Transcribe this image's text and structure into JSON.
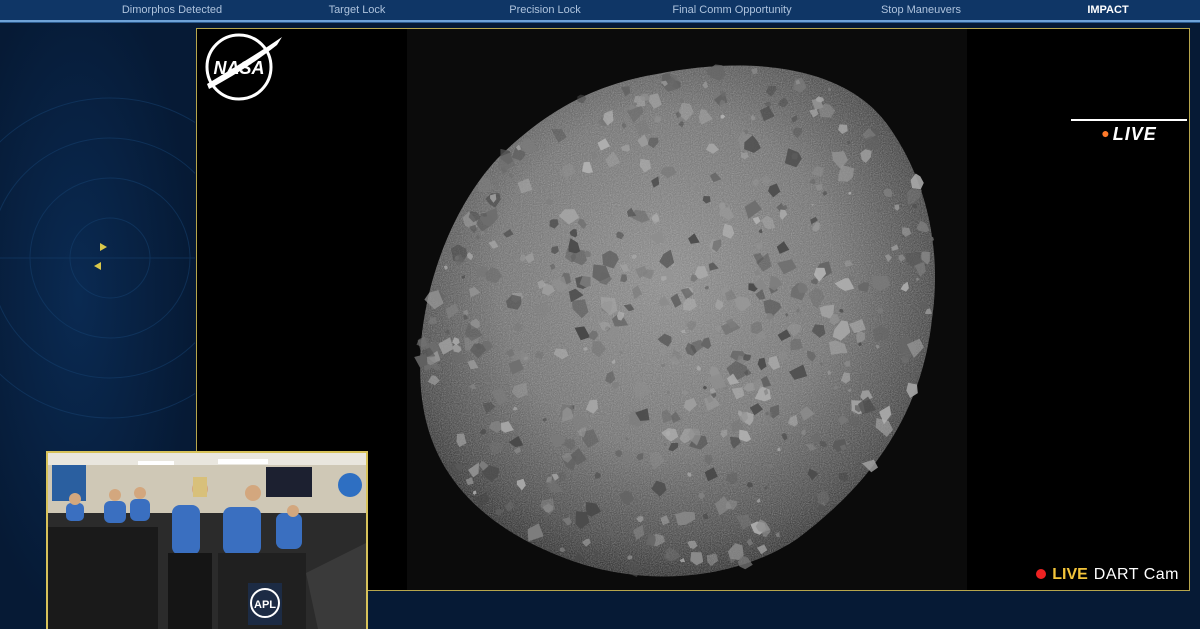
{
  "milestones": [
    {
      "label": "Dimorphos Detected",
      "active": false
    },
    {
      "label": "Target Lock",
      "active": false
    },
    {
      "label": "Precision Lock",
      "active": false
    },
    {
      "label": "Final Comm Opportunity",
      "active": false
    },
    {
      "label": "Stop Maneuvers",
      "active": false
    },
    {
      "label": "IMPACT",
      "active": true
    }
  ],
  "broadcast": {
    "logo_text": "NASA",
    "live_label": "LIVE",
    "feed_live": "LIVE",
    "feed_name": "DART Cam"
  },
  "pip": {
    "sign_text": "APL"
  },
  "colors": {
    "background": "#061a35",
    "topbar": "#0f3666",
    "frame_border": "#b7a64c",
    "live_yellow": "#f3c43a",
    "rec_red": "#e22222",
    "live_dot": "#ff7a2a"
  }
}
